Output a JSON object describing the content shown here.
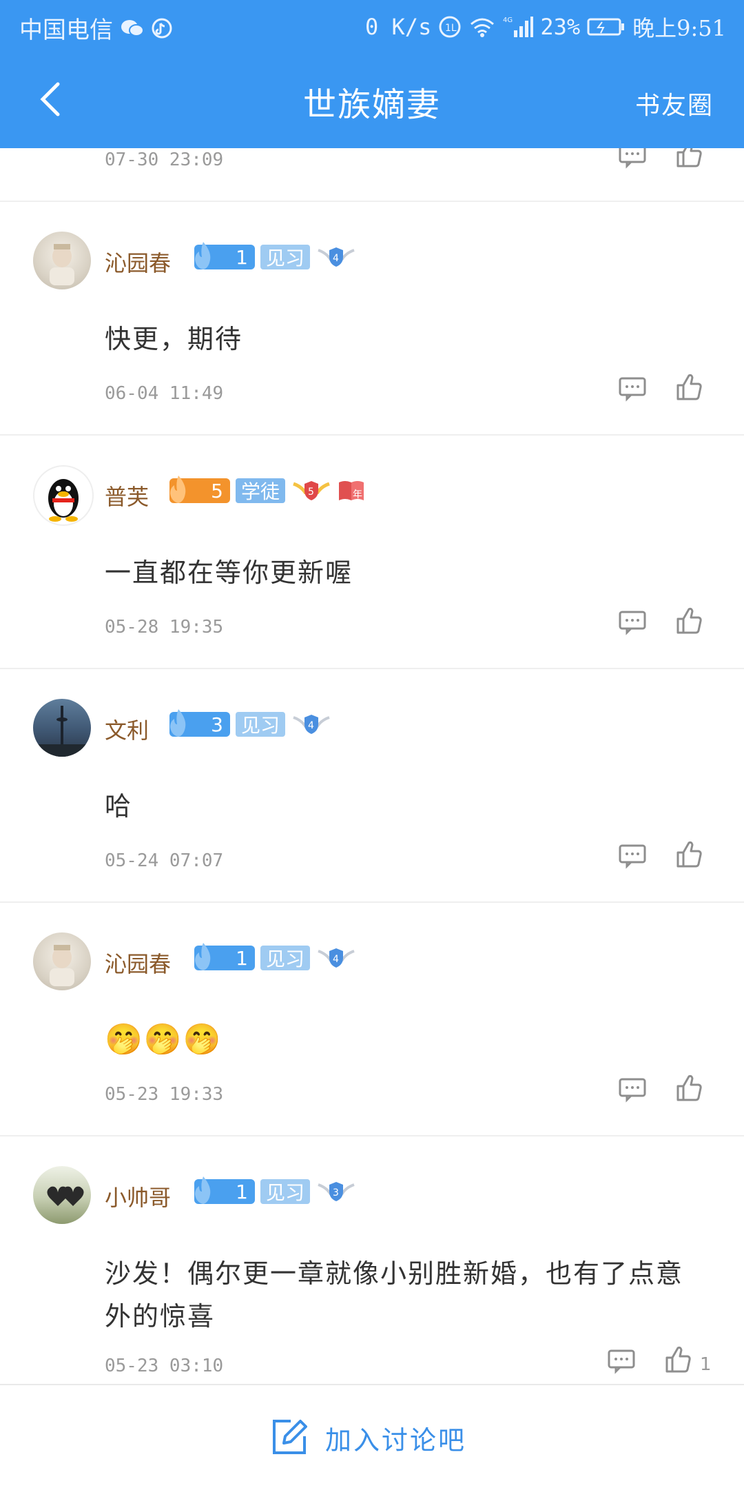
{
  "status_bar": {
    "carrier": "中国电信",
    "net_speed": "0 K/s",
    "battery": "23%",
    "time": "晚上9:51"
  },
  "header": {
    "title": "世族嫡妻",
    "right_link": "书友圈"
  },
  "partial_top": {
    "time": "07-30 23:09"
  },
  "comments": [
    {
      "name": "沁园春",
      "level": "1",
      "title_tag": "见习",
      "wing_level": "4",
      "text": "快更，期待",
      "time": "06-04 11:49",
      "likes": ""
    },
    {
      "name": "普芙",
      "level": "5",
      "title_tag": "学徒",
      "wing_level": "5",
      "year_badge": "年",
      "text": "一直都在等你更新喔",
      "time": "05-28 19:35",
      "likes": ""
    },
    {
      "name": "文利",
      "level": "3",
      "title_tag": "见习",
      "wing_level": "4",
      "text": "哈",
      "time": "05-24 07:07",
      "likes": ""
    },
    {
      "name": "沁园春",
      "level": "1",
      "title_tag": "见习",
      "wing_level": "4",
      "text": "🤭🤭🤭",
      "time": "05-23 19:33",
      "likes": ""
    },
    {
      "name": "小帅哥",
      "level": "1",
      "title_tag": "见习",
      "wing_level": "3",
      "text_line1": "沙发！偶尔更一章就像小别胜新婚，也有了点意",
      "text_line2": "外的惊喜",
      "time": "05-23 03:10",
      "likes": "1"
    }
  ],
  "bottom_bar": {
    "label": "加入讨论吧"
  },
  "colors": {
    "primary": "#3a97f2",
    "username": "#8b5a2b",
    "level_blue": "#4aa0ef",
    "level_orange": "#f3932c"
  }
}
